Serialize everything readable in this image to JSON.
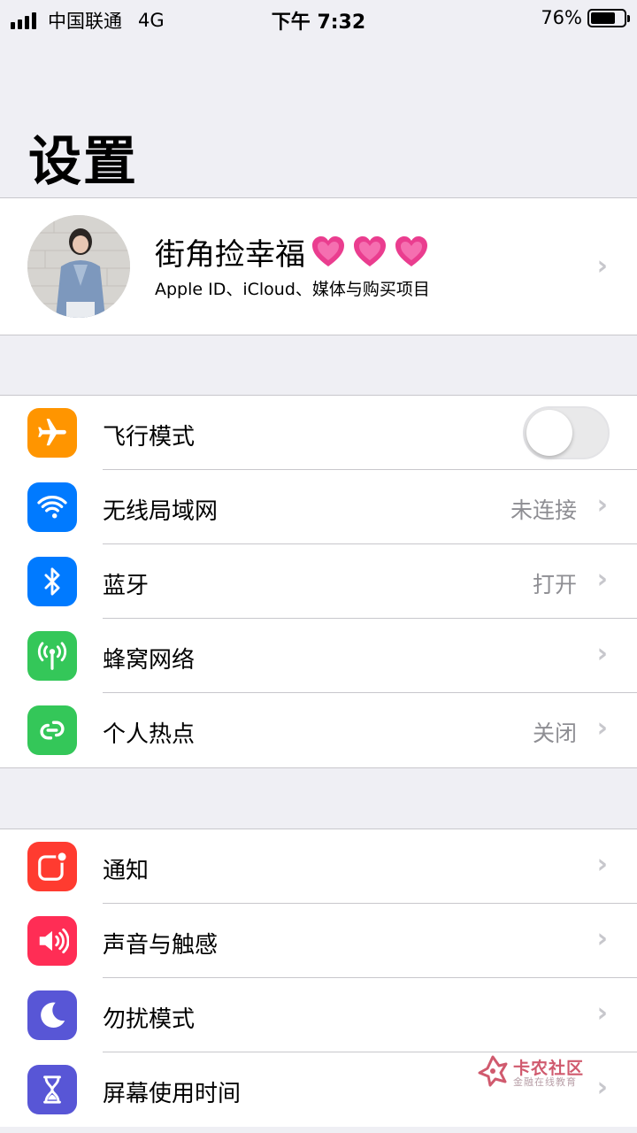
{
  "status_bar": {
    "carrier": "中国联通",
    "network": "4G",
    "time": "下午 7:32",
    "battery": "76%",
    "battery_level": 0.76
  },
  "title": "设置",
  "profile": {
    "name": "街角捡幸福",
    "name_emoji": "💓💓💓",
    "subtitle": "Apple ID、iCloud、媒体与购买项目"
  },
  "group1": {
    "rows": [
      {
        "label": "飞行模式",
        "icon": "airplane-icon",
        "color": "#ff9500",
        "toggle": false
      },
      {
        "label": "无线局域网",
        "icon": "wifi-icon",
        "color": "#007aff",
        "value": "未连接"
      },
      {
        "label": "蓝牙",
        "icon": "bluetooth-icon",
        "color": "#007aff",
        "value": "打开"
      },
      {
        "label": "蜂窝网络",
        "icon": "cellular-icon",
        "color": "#34c759",
        "value": ""
      },
      {
        "label": "个人热点",
        "icon": "hotspot-icon",
        "color": "#34c759",
        "value": "关闭"
      }
    ]
  },
  "group2": {
    "rows": [
      {
        "label": "通知",
        "icon": "notifications-icon",
        "color": "#ff3b30"
      },
      {
        "label": "声音与触感",
        "icon": "sound-icon",
        "color": "#ff2d55"
      },
      {
        "label": "勿扰模式",
        "icon": "moon-icon",
        "color": "#5856d6"
      },
      {
        "label": "屏幕使用时间",
        "icon": "hourglass-icon",
        "color": "#5856d6"
      }
    ]
  },
  "watermark": {
    "title": "卡农社区",
    "subtitle": "金融在线教育"
  }
}
